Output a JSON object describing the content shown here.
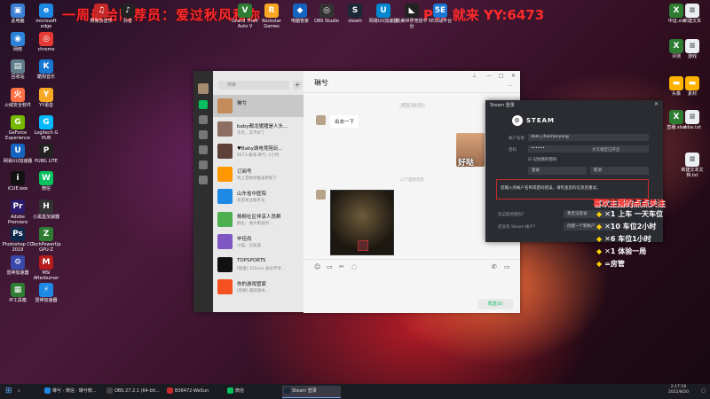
{
  "banner": {
    "left": "一周最给阿荐员：爱过秋风和你",
    "right": "PW 就来 YY:6473"
  },
  "desktop_left": [
    {
      "label": "此电脑",
      "color": "#3b7fd6",
      "glyph": "▣"
    },
    {
      "label": "microsoft edge",
      "color": "#1e88e5",
      "glyph": "e"
    },
    {
      "label": "网络",
      "color": "#2b82d9",
      "glyph": "◉"
    },
    {
      "label": "chrome",
      "color": "#e53935",
      "glyph": "◎"
    },
    {
      "label": "回收站",
      "color": "#607d8b",
      "glyph": "▤"
    },
    {
      "label": "酷狗音乐",
      "color": "#1976d2",
      "glyph": "K"
    },
    {
      "label": "火绒安全软件",
      "color": "#ff7043",
      "glyph": "火"
    },
    {
      "label": "YY语音",
      "color": "#f9a825",
      "glyph": "Y"
    },
    {
      "label": "GeForce Experience",
      "color": "#76b900",
      "glyph": "G"
    },
    {
      "label": "Logitech G HUB",
      "color": "#00b8fc",
      "glyph": "G"
    },
    {
      "label": "网易UU加速器",
      "color": "#1565c0",
      "glyph": "U"
    },
    {
      "label": "PUBG LITE",
      "color": "#222",
      "glyph": "P"
    },
    {
      "label": "iCUE.exe",
      "color": "#111",
      "glyph": "i"
    },
    {
      "label": "微信",
      "color": "#07c160",
      "glyph": "W"
    },
    {
      "label": "Adobe Premiere",
      "color": "#2c1a6b",
      "glyph": "Pr"
    },
    {
      "label": "小黑盒加速器",
      "color": "#333",
      "glyph": "H"
    },
    {
      "label": "Photoshop CC 2019",
      "color": "#0d2a4d",
      "glyph": "Ps"
    },
    {
      "label": "TechPowerUp GPU-Z",
      "color": "#2e7d32",
      "glyph": "Z"
    },
    {
      "label": "雷神加速器",
      "color": "#3949ab",
      "glyph": "⚙"
    },
    {
      "label": "MSI Afterburner",
      "color": "#b71c1c",
      "glyph": "M"
    },
    {
      "label": "IP工具箱",
      "color": "#2e7d32",
      "glyph": "▦"
    },
    {
      "label": "雷神加速器",
      "color": "#1e88e5",
      "glyph": "⚡"
    }
  ],
  "desktop_top": [
    {
      "label": "网易云音乐",
      "color": "#c62828",
      "glyph": "♫"
    },
    {
      "label": "抖音",
      "color": "#222",
      "glyph": "♪"
    },
    {
      "label": "Grand Theft Auto V",
      "color": "#2e7d32",
      "glyph": "V"
    },
    {
      "label": "Rockstar Games",
      "color": "#f9a825",
      "glyph": "R"
    },
    {
      "label": "电脑管家",
      "color": "#1565c0",
      "glyph": "◆"
    },
    {
      "label": "OBS Studio",
      "color": "#333",
      "glyph": "◎"
    },
    {
      "label": "steam",
      "color": "#1b2838",
      "glyph": "S"
    },
    {
      "label": "网易UU加速器",
      "color": "#0288d1",
      "glyph": "U"
    },
    {
      "label": "完美世界竞技平台",
      "color": "#222",
      "glyph": "◣"
    },
    {
      "label": "5E对战平台",
      "color": "#1976d2",
      "glyph": "5E"
    }
  ],
  "desktop_right": [
    {
      "label": "中证.xls",
      "color": "#2e7d32",
      "glyph": "X"
    },
    {
      "label": "新建文本",
      "color": "#eceff1",
      "glyph": "≡"
    },
    {
      "label": "评测",
      "color": "#2e7d32",
      "glyph": "X"
    },
    {
      "label": "游戏",
      "color": "#eceff1",
      "glyph": "≡"
    },
    {
      "label": "头像",
      "color": "#ffb300",
      "glyph": "▬"
    },
    {
      "label": "素材",
      "color": "#ffb300",
      "glyph": "▬"
    },
    {
      "label": "直播.xlsx",
      "color": "#2e7d32",
      "glyph": "X"
    },
    {
      "label": "ddss.txt",
      "color": "#eceff1",
      "glyph": "≡"
    },
    {
      "label": "新建文本文档.txt",
      "color": "#eceff1",
      "glyph": "≡"
    }
  ],
  "wechat": {
    "search_placeholder": "搜索",
    "contacts": [
      {
        "name": "琳兮",
        "preview": "",
        "color": "#c48b5b"
      },
      {
        "name": "baby都龙猪猪是人头...",
        "preview": "亲亲，又不好了",
        "color": "#8d6e63"
      },
      {
        "name": "♥Baby城电竞陪玩...",
        "preview": "6473-秦城·琳兮, 2小时",
        "color": "#5d4037"
      },
      {
        "name": "订阅号",
        "preview": "周上官给你推送更新了",
        "color": "#ff9800"
      },
      {
        "name": "山东省中医院",
        "preview": "欢迎关注服务号",
        "color": "#1e88e5"
      },
      {
        "name": "杨柳社区伴享人员群",
        "preview": "群主：请大家准时...",
        "color": "#4caf50"
      },
      {
        "name": "毕佳尚",
        "preview": "小猫，已知道",
        "color": "#7e57c2"
      },
      {
        "name": "TOPSPORTS",
        "preview": "[链接] 150xxx 会员专享...",
        "color": "#111"
      },
      {
        "name": "你的游戏管家",
        "preview": "[链接] 最新版本...",
        "color": "#f4511e"
      }
    ],
    "chat": {
      "title": "琳兮",
      "time1": "昨天 19:15",
      "msg1": "出去一下",
      "sticker": "好哒",
      "time2": "以下是新消息",
      "send_label": "发送(S)"
    }
  },
  "steam": {
    "window_title": "Steam 登录",
    "logo": "STEAM",
    "username_label": "帐户名称",
    "username_value": "dam_chenhanyang",
    "password_label": "密码",
    "password_value": "••••••",
    "caps_hint": "大写锁定已开启",
    "remember": "记住我的密码",
    "login_button": "登录",
    "cancel_button": "取消",
    "error": "您输入的帐户名称或密码错误，请检查您的信息后重试。",
    "forgot_label": "忘记您的密码？",
    "forgot_button": "我无法登录",
    "no_account_label": "还没有 Steam 帐户？",
    "create_button": "创建一个新帐户"
  },
  "promo": {
    "heading": "喜欢主播的点点关注",
    "rows": [
      "✕1 上车 一天车位",
      "✕10 车位2小时",
      "✕6 车位1小时",
      "✕1 体验一局",
      "=房管"
    ]
  },
  "taskbar": {
    "items": [
      {
        "label": "琳兮 - 微信 · 琳兮微...",
        "color": "#1e88e5"
      },
      {
        "label": "OBS 27.2.1 (64-bit...",
        "color": "#444"
      },
      {
        "label": "B36472-WeSun",
        "color": "#c62828"
      },
      {
        "label": "微信",
        "color": "#07c160"
      },
      {
        "label": "Steam 登录",
        "color": "#1b2838"
      }
    ],
    "time": "2:17:18",
    "date": "2022/8/20"
  }
}
